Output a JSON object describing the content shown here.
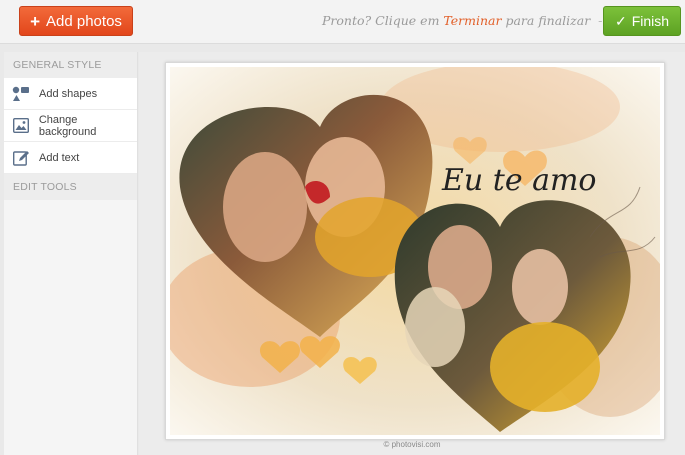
{
  "toolbar": {
    "add_photos_label": "Add photos",
    "hint_prefix": "Pronto? Clique em",
    "hint_link": "Terminar",
    "hint_suffix": "para finalizar",
    "finish_label": "Finish"
  },
  "sidebar": {
    "section_general": "GENERAL STYLE",
    "items": [
      {
        "label": "Add shapes",
        "icon": "shapes-icon"
      },
      {
        "label": "Change background",
        "icon": "background-image-icon"
      },
      {
        "label": "Add text",
        "icon": "edit-text-icon"
      }
    ],
    "section_edit": "EDIT TOOLS"
  },
  "canvas": {
    "caption": "Eu te amo",
    "credit": "© photovisi.com"
  },
  "colors": {
    "add_button": "#e8501f",
    "finish_button": "#6cb22c",
    "hint_link": "#e2602a"
  }
}
